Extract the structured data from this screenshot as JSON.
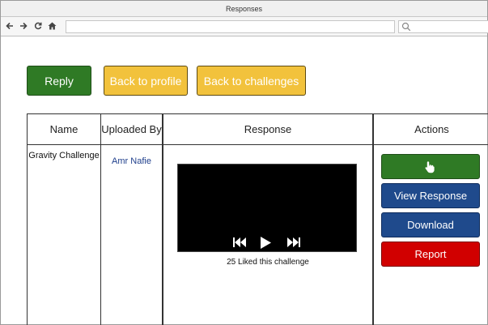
{
  "window": {
    "title": "Responses"
  },
  "browser": {
    "url": "",
    "search_placeholder": ""
  },
  "toolbar": {
    "reply_label": "Reply",
    "back_profile_label": "Back to profile",
    "back_challenges_label": "Back to challenges"
  },
  "table": {
    "headers": {
      "name": "Name",
      "uploaded_by": "Uploaded By",
      "response": "Response",
      "actions": "Actions"
    },
    "rows": [
      {
        "name": "Gravity Challenge",
        "uploaded_by": "Amr Nafie",
        "likes_text": "25 Liked this challenge",
        "actions": {
          "like_icon": "thumbs-up-hand-icon",
          "view_label": "View Response",
          "download_label": "Download",
          "report_label": "Report"
        }
      }
    ]
  },
  "colors": {
    "green": "#2f7a25",
    "yellow": "#f2c23c",
    "blue": "#1f4a8c",
    "red": "#d10000",
    "link": "#1f3f8c"
  }
}
